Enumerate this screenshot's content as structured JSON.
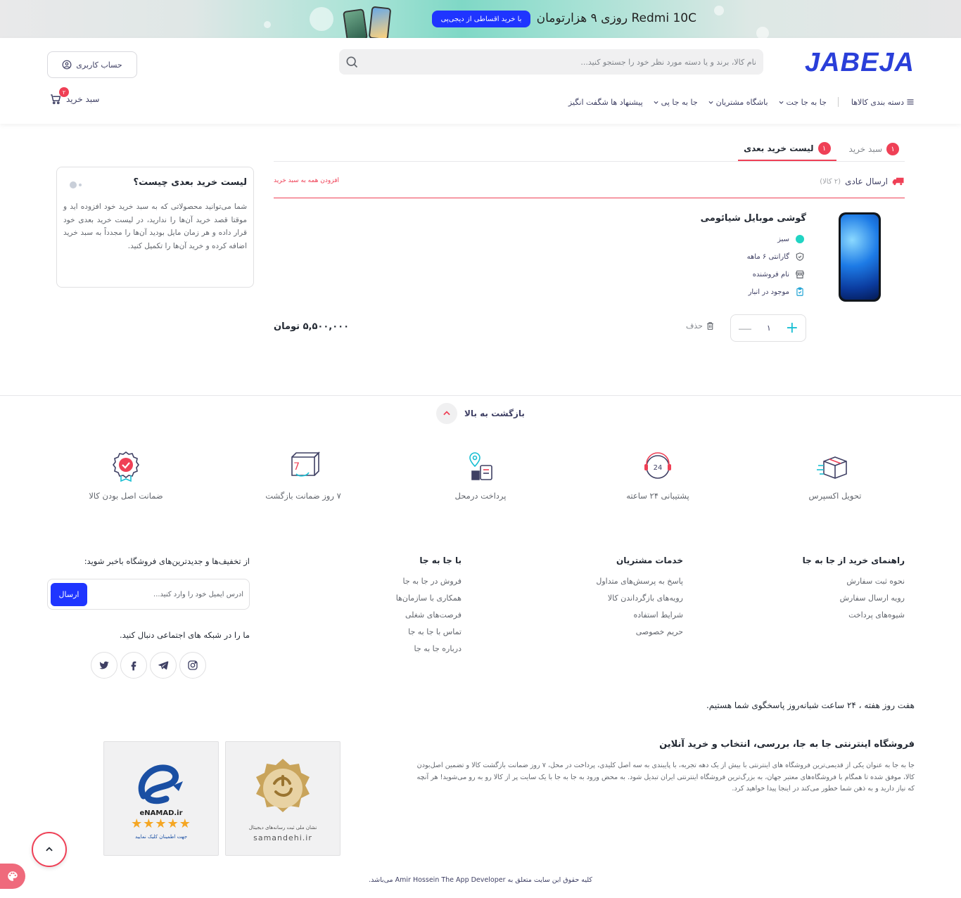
{
  "promo": {
    "headline": "Redmi 10C روزی ۹ هزارتومان",
    "pill": "با خرید اقساطی از دیجی‌پی"
  },
  "header": {
    "logo": "JABEJA",
    "search_placeholder": "نام کالا، برند و یا دسته مورد نظر خود را جستجو کنید...",
    "account": "حساب کاربری",
    "cart": "سبد خرید",
    "cart_count": "۲",
    "nav": [
      {
        "label": "دسته بندی کالاها"
      },
      {
        "label": "جا به جا جت"
      },
      {
        "label": "باشگاه مشتریان"
      },
      {
        "label": "جا به جا پی"
      },
      {
        "label": "پیشنهاد ها شگفت انگیز"
      }
    ]
  },
  "tabs": [
    {
      "label": "سبد خرید",
      "count": "۱"
    },
    {
      "label": "لیست خرید بعدی",
      "count": "۱"
    }
  ],
  "shipping": {
    "label": "ارسال عادی",
    "count": "(۲ کالا)",
    "add_all": "افزودن همه به سبد خرید"
  },
  "product": {
    "title": "گوشی موبایل شیائومی",
    "color": "سبز",
    "color_hex": "#21d4c3",
    "warranty": "گارانتی ۶ ماهه",
    "seller": "نام فروشنده",
    "stock": "موجود در انبار",
    "quantity": "۱",
    "delete": "حذف",
    "price": "۵,۵۰۰,۰۰۰ تومان"
  },
  "info_box": {
    "title": "لیست خرید بعدی چیست؟",
    "text": "شما می‌توانید محصولاتی که به سبد خرید خود افزوده اید و موقتا قصد خرید آن‌ها را ندارید، در لیست خرید بعدی خود قرار داده و هر زمان مایل بودید آن‌ها را مجدداً به سبد خرید اضافه کرده و خرید آن‌ها را تکمیل کنید."
  },
  "back_to_top": "بازگشت به بالا",
  "features": [
    {
      "label": "تحویل اکسپرس",
      "icon": "express-delivery-icon"
    },
    {
      "label": "پشتیبانی ۲۴ ساعته",
      "icon": "support-24-icon"
    },
    {
      "label": "پرداخت درمحل",
      "icon": "pay-on-delivery-icon"
    },
    {
      "label": "۷ روز ضمانت بازگشت",
      "icon": "return-guarantee-icon"
    },
    {
      "label": "ضمانت اصل بودن کالا",
      "icon": "original-guarantee-icon"
    }
  ],
  "footer": {
    "guide": {
      "title": "راهنمای خرید از جا به جا",
      "links": [
        "نحوه ثبت سفارش",
        "رویه ارسال سفارش",
        "شیوه‌های پرداخت"
      ]
    },
    "services": {
      "title": "خدمات مشتریان",
      "links": [
        "پاسخ به پرسش‌های متداول",
        "رویه‌های بازگرداندن کالا",
        "شرایط استفاده",
        "حریم خصوصی"
      ]
    },
    "company": {
      "title": "با جا به جا",
      "links": [
        "فروش در جا به جا",
        "همکاری با سازمان‌ها",
        "فرصت‌های شغلی",
        "تماس با جا به جا",
        "درباره جا به جا"
      ]
    },
    "newsletter_title": "از تخفیف‌ها و جدیدترین‌های فروشگاه باخبر شوید:",
    "newsletter_placeholder": "آدرس ایمیل خود را وارد کنید...",
    "newsletter_button": "ارسال",
    "social_title": "ما را در شبکه های اجتماعی دنبال کنید.",
    "support_line": "هفت روز هفته ، ۲۴ ساعت شبانه‌روز پاسخگوی شما هستیم.",
    "about_title": "فروشگاه اینترنتی جا به جا، بررسی، انتخاب و خرید آنلاین",
    "about_text": "جا به جا به عنوان یکی از قدیمی‌ترین فروشگاه های اینترنتی با بیش از یک دهه تجربه، با پایبندی به سه اصل کلیدی، پرداخت در محل، ۷ روز ضمانت بازگشت کالا و تضمین اصل‌بودن کالا، موفق شده تا همگام با فروشگاه‌های معتبر جهان، به بزرگ‌ترین فروشگاه اینترنتی ایران تبدیل شود. به محض ورود به جا به جا با یک سایت پر از کالا رو به رو می‌شوید! هر آنچه که نیاز دارید و به ذهن شما خطور می‌کند در اینجا پیدا خواهید کرد.",
    "samandehi_caption": "samandehi.ir",
    "samandehi_sub": "نشان ملی ثبت رسانه‌های دیجیتال",
    "enamad_caption": "eNAMAD.ir",
    "enamad_sub": "جهت اطمینان کلیک نمایید",
    "copyright": "کلیه حقوق این سایت متعلق به Amir Hossein The App Developer می‌باشد."
  },
  "colors": {
    "accent": "#ef4056",
    "brand": "#2a3fd9",
    "button": "#1f35ff",
    "teal": "#19bfd3"
  }
}
